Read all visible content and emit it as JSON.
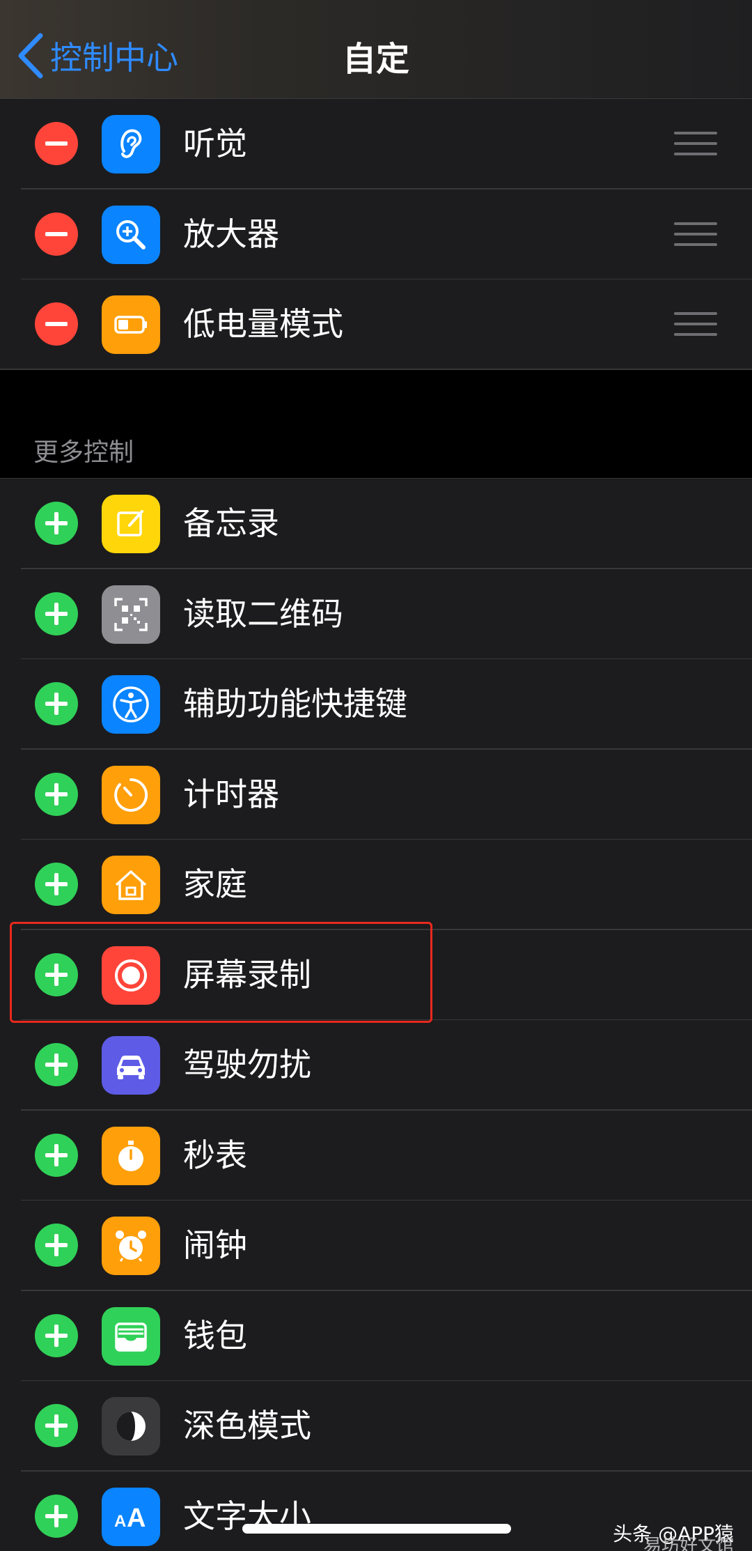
{
  "nav": {
    "back_label": "控制中心",
    "title": "自定"
  },
  "included": [
    {
      "label": "听觉",
      "icon": "ear-icon",
      "color": "#0a84ff"
    },
    {
      "label": "放大器",
      "icon": "magnifier-icon",
      "color": "#0a84ff"
    },
    {
      "label": "低电量模式",
      "icon": "battery-icon",
      "color": "#ff9f0a"
    }
  ],
  "more_header": "更多控制",
  "more": [
    {
      "label": "备忘录",
      "icon": "notes-icon",
      "color": "#ffd60a"
    },
    {
      "label": "读取二维码",
      "icon": "qr-code-icon",
      "color": "#8e8e93"
    },
    {
      "label": "辅助功能快捷键",
      "icon": "accessibility-icon",
      "color": "#0a84ff"
    },
    {
      "label": "计时器",
      "icon": "timer-icon",
      "color": "#ff9f0a"
    },
    {
      "label": "家庭",
      "icon": "home-icon",
      "color": "#ff9f0a"
    },
    {
      "label": "屏幕录制",
      "icon": "screen-record-icon",
      "color": "#ff453a"
    },
    {
      "label": "驾驶勿扰",
      "icon": "car-icon",
      "color": "#5e5ce6"
    },
    {
      "label": "秒表",
      "icon": "stopwatch-icon",
      "color": "#ff9f0a"
    },
    {
      "label": "闹钟",
      "icon": "alarm-icon",
      "color": "#ff9f0a"
    },
    {
      "label": "钱包",
      "icon": "wallet-icon",
      "color": "#30d158"
    },
    {
      "label": "深色模式",
      "icon": "dark-mode-icon",
      "color": "#3a3a3c"
    },
    {
      "label": "文字大小",
      "icon": "text-size-icon",
      "color": "#0a84ff"
    }
  ],
  "watermark": {
    "line1": "头条 @APP猿",
    "line2": "易坊好文馆"
  }
}
